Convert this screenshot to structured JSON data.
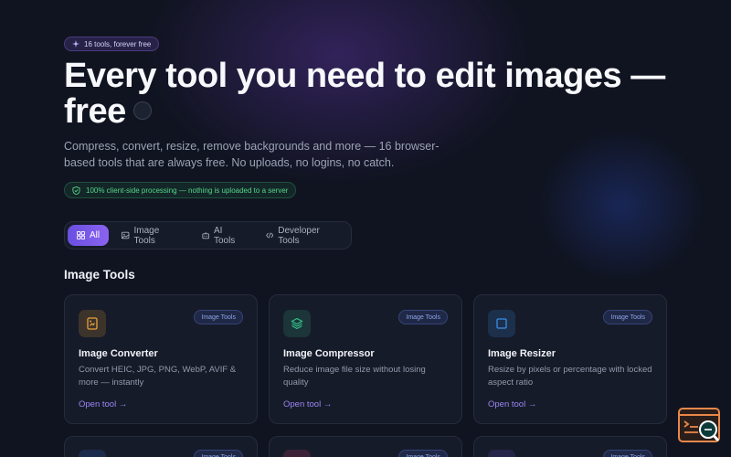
{
  "hero": {
    "badge": "16 tools, forever free",
    "headline": "Every tool you need to edit images — free",
    "subtitle": "Compress, convert, resize, remove backgrounds and more — 16 browser-based tools that are always free. No uploads, no logins, no catch.",
    "privacy_note": "100% client-side processing — nothing is uploaded to a server"
  },
  "tabs": [
    {
      "label": "All",
      "icon": "grid-icon",
      "active": true
    },
    {
      "label": "Image Tools",
      "icon": "image-icon",
      "active": false
    },
    {
      "label": "AI Tools",
      "icon": "robot-icon",
      "active": false
    },
    {
      "label": "Developer Tools",
      "icon": "code-icon",
      "active": false
    }
  ],
  "section": {
    "title": "Image Tools"
  },
  "cards": [
    {
      "category": "Image Tools",
      "title": "Image Converter",
      "description": "Convert HEIC, JPG, PNG, WebP, AVIF & more — instantly",
      "link": "Open tool →",
      "icon": "image-convert-icon",
      "accent": "#e8a23a"
    },
    {
      "category": "Image Tools",
      "title": "Image Compressor",
      "description": "Reduce image file size without losing quality",
      "link": "Open tool →",
      "icon": "layers-icon",
      "accent": "#35c08a"
    },
    {
      "category": "Image Tools",
      "title": "Image Resizer",
      "description": "Resize by pixels or percentage with locked aspect ratio",
      "link": "Open tool →",
      "icon": "resize-square-icon",
      "accent": "#3a8ee8"
    }
  ],
  "row2": [
    {
      "category": "Image Tools",
      "accent": "#3a6ee8"
    },
    {
      "category": "Image Tools",
      "accent": "#e8457a"
    },
    {
      "category": "Image Tools",
      "accent": "#6a4fe0"
    }
  ]
}
